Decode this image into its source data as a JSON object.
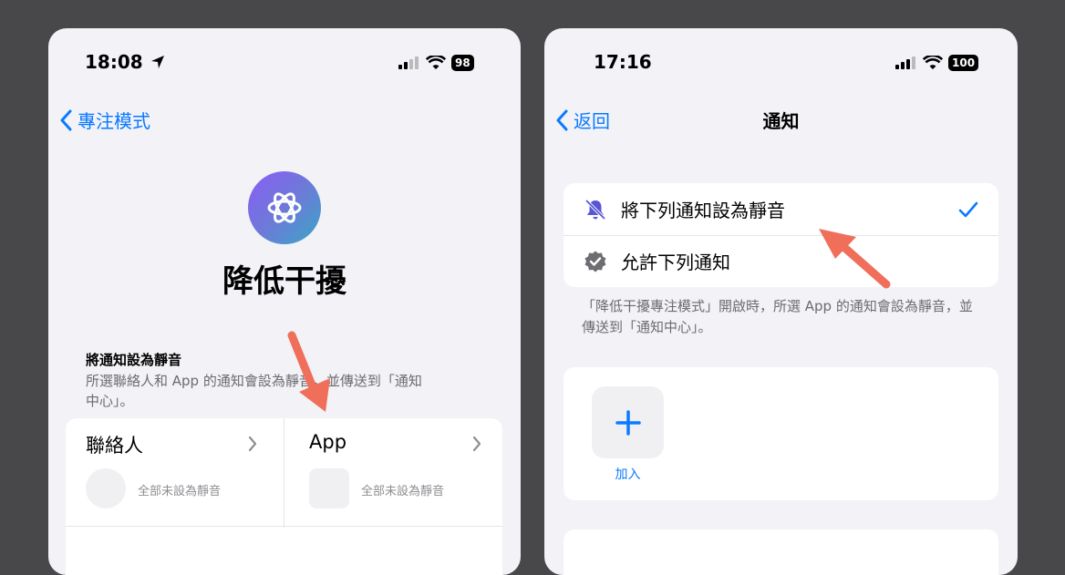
{
  "left_phone": {
    "status_time": "18:08",
    "battery": "98",
    "back_label": "專注模式",
    "focus_title": "降低干擾",
    "section_heading": "將通知設為靜音",
    "section_desc": "所選聯絡人和 App 的通知會設為靜音，並傳送到「通知中心」。",
    "contacts_title": "聯絡人",
    "contacts_sub": "全部未設為靜音",
    "apps_title": "App",
    "apps_sub": "全部未設為靜音"
  },
  "right_phone": {
    "status_time": "17:16",
    "battery": "100",
    "back_label": "返回",
    "nav_title": "通知",
    "options": [
      {
        "label": "將下列通知設為靜音",
        "selected": true
      },
      {
        "label": "允許下列通知",
        "selected": false
      }
    ],
    "note": "「降低干擾專注模式」開啟時，所選 App 的通知會設為靜音，並傳送到「通知中心」。",
    "add_label": "加入"
  },
  "colors": {
    "accent": "#0a7aff",
    "arrow": "#ef6f5a",
    "background": "#48484a",
    "screen": "#f2f2f7"
  },
  "icons": [
    "location-arrow-icon",
    "signal-icon",
    "wifi-icon",
    "battery-icon",
    "chevron-left-icon",
    "focus-mode-icon",
    "chevron-right-icon",
    "bell-slash-icon",
    "verified-badge-icon",
    "checkmark-icon",
    "plus-icon"
  ]
}
